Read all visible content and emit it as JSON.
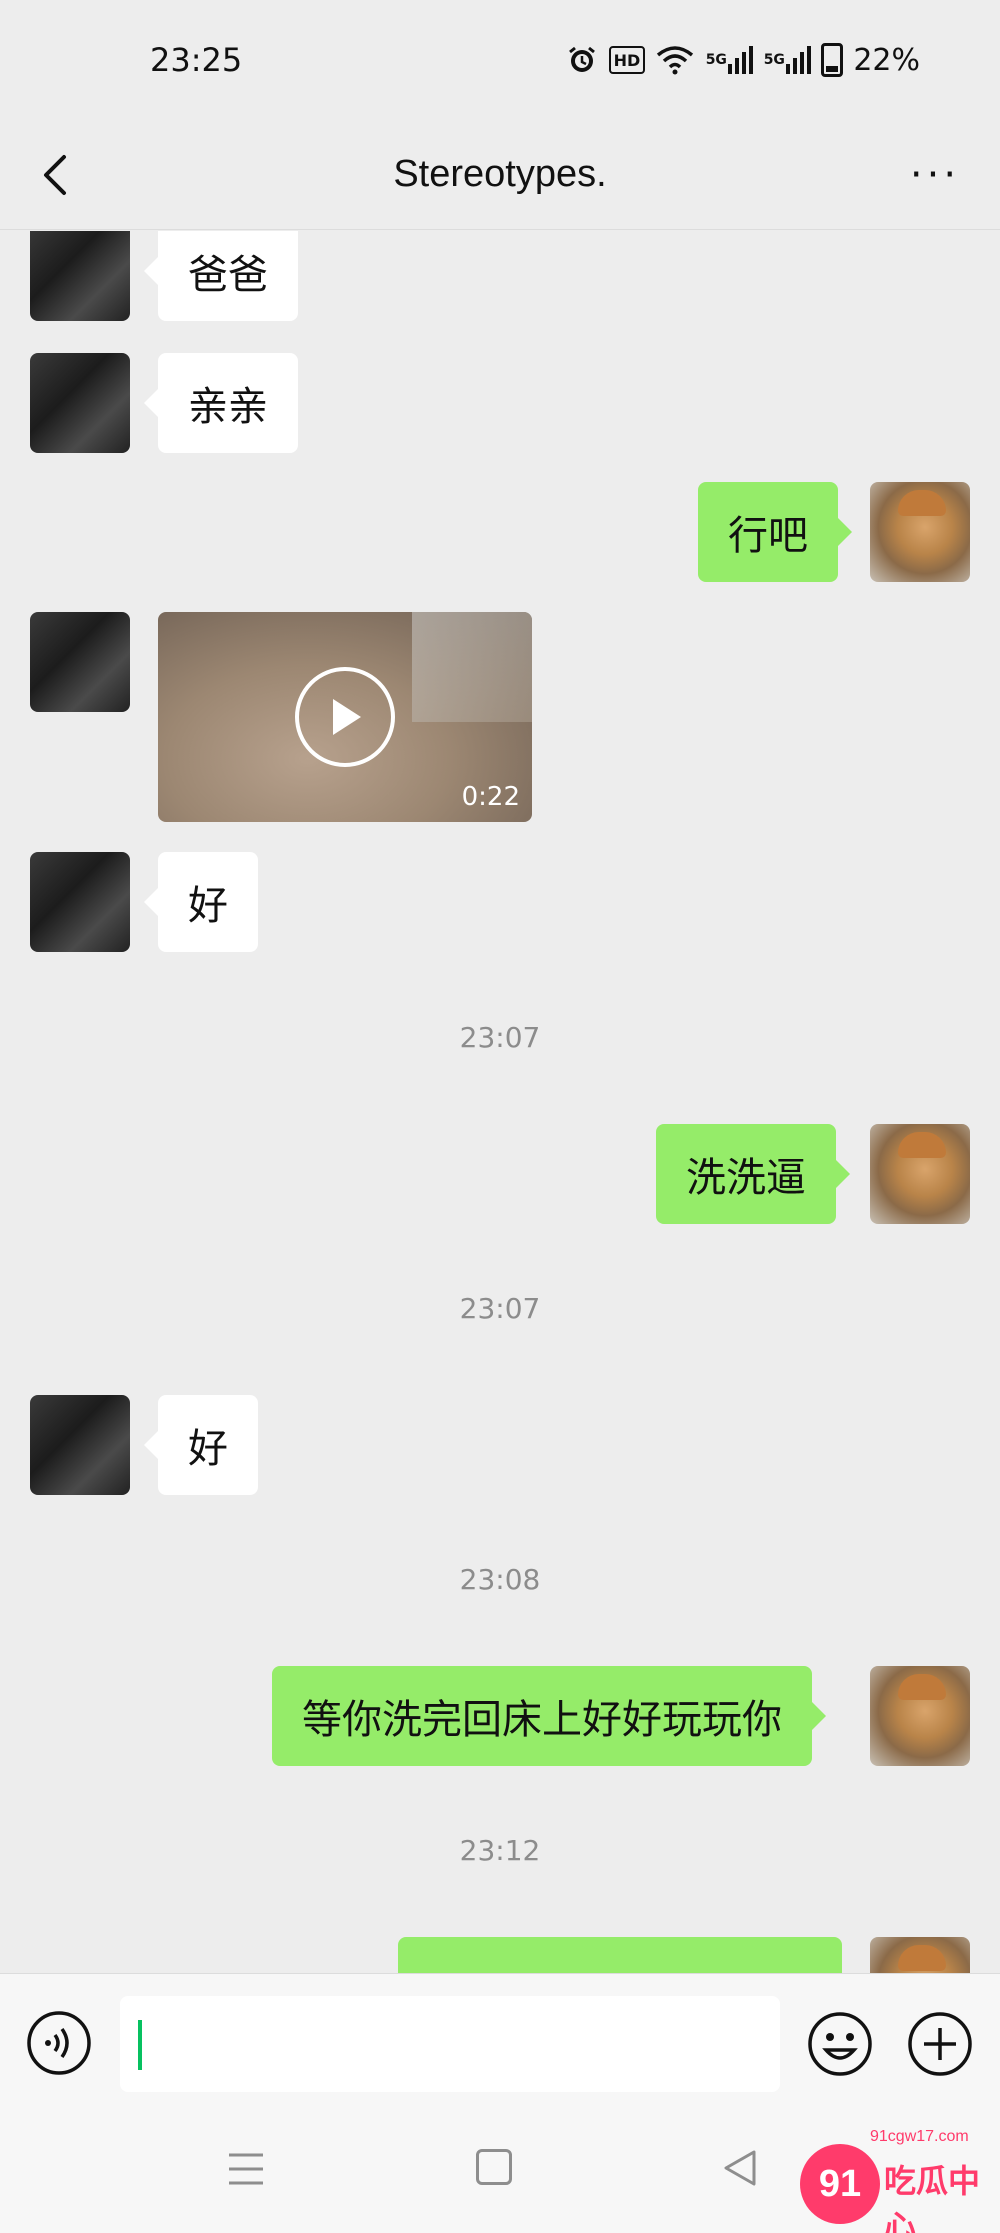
{
  "status_bar": {
    "time": "23:25",
    "hd_label": "HD",
    "signal_1_label": "5G",
    "signal_2_label": "5G",
    "battery": "22%"
  },
  "header": {
    "title": "Stereotypes.",
    "more_label": "···"
  },
  "messages": [
    {
      "side": "left",
      "type": "text",
      "text": "爸爸"
    },
    {
      "side": "left",
      "type": "text",
      "text": "亲亲"
    },
    {
      "side": "right",
      "type": "text",
      "text": "行吧"
    },
    {
      "side": "left",
      "type": "video",
      "duration": "0:22"
    },
    {
      "side": "left",
      "type": "text",
      "text": "好"
    },
    {
      "type": "timestamp",
      "text": "23:07"
    },
    {
      "side": "right",
      "type": "text",
      "text": "洗洗逼"
    },
    {
      "type": "timestamp",
      "text": "23:07"
    },
    {
      "side": "left",
      "type": "text",
      "text": "好"
    },
    {
      "type": "timestamp",
      "text": "23:08"
    },
    {
      "side": "right",
      "type": "text",
      "text": "等你洗完回床上好好玩玩你"
    },
    {
      "type": "timestamp",
      "text": "23:12"
    },
    {
      "side": "right",
      "type": "text",
      "text": ""
    }
  ],
  "input": {
    "value": "",
    "placeholder": ""
  },
  "watermark": {
    "logo": "91",
    "url": "91cgw17.com",
    "name": "吃瓜中心"
  },
  "colors": {
    "background": "#ededed",
    "self_bubble": "#95ec69",
    "other_bubble": "#ffffff",
    "timestamp": "#8c8c8c",
    "caret": "#07c160"
  },
  "icons": [
    "back-icon",
    "more-icon",
    "play-icon",
    "voice-icon",
    "emoji-icon",
    "plus-icon",
    "menu-key-icon",
    "home-key-icon",
    "back-key-icon"
  ]
}
